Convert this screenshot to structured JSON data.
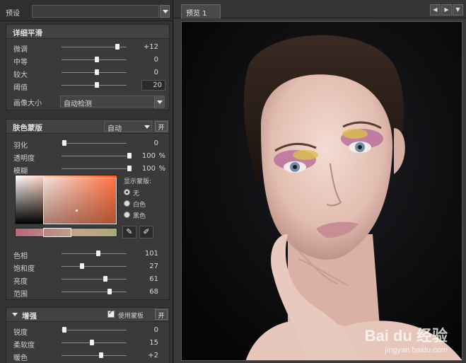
{
  "preset": {
    "label": "预设",
    "value": ""
  },
  "detail_smoothing": {
    "title": "详细平滑",
    "rows": [
      {
        "label": "微调",
        "value": "+12",
        "level": 0.82
      },
      {
        "label": "中等",
        "value": "0",
        "level": 0.5
      },
      {
        "label": "较大",
        "value": "0",
        "level": 0.5
      },
      {
        "label": "阈值",
        "value": "20",
        "level": 0.5
      }
    ],
    "image_size_label": "画像大小",
    "image_size_value": "自动检测"
  },
  "skin_mask": {
    "title": "肤色蒙版",
    "mode_value": "自动",
    "toggle_label": "开",
    "rows": [
      {
        "label": "羽化",
        "value": "0",
        "unit": "",
        "level": 0.0
      },
      {
        "label": "透明度",
        "value": "100",
        "unit": "%",
        "level": 1.0
      },
      {
        "label": "模糊",
        "value": "100",
        "unit": "%",
        "level": 1.0
      }
    ],
    "show_mask_label": "显示蒙版:",
    "radio_options": [
      "无",
      "白色",
      "黑色"
    ],
    "selected_radio": 0,
    "hsl_rows": [
      {
        "label": "色相",
        "value": "101",
        "level": 0.52
      },
      {
        "label": "饱和度",
        "value": "27",
        "level": 0.27
      },
      {
        "label": "亮度",
        "value": "61",
        "level": 0.63
      },
      {
        "label": "范围",
        "value": "68",
        "level": 0.7
      }
    ]
  },
  "enhance": {
    "title": "增强",
    "use_mask_label": "使用蒙板",
    "use_mask_checked": true,
    "toggle_label": "开",
    "rows": [
      {
        "label": "锐度",
        "value": "0",
        "level": 0.0
      },
      {
        "label": "柔软度",
        "value": "15",
        "level": 0.42
      },
      {
        "label": "暖色",
        "value": "+2",
        "level": 0.56
      }
    ]
  },
  "preview": {
    "tab_label": "预览 1",
    "watermark_logo": "Bai du 经验",
    "watermark_url": "jingyan.baidu.com"
  }
}
